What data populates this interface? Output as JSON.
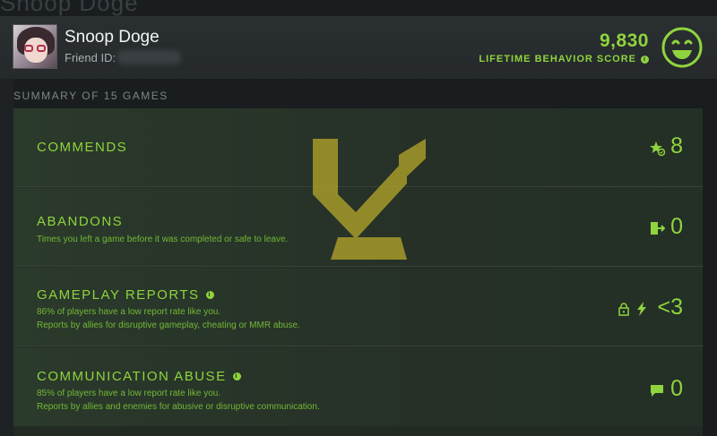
{
  "header": {
    "user_name": "Snoop Doge",
    "friend_id_label": "Friend ID:",
    "score": "9,830",
    "score_label": "LIFETIME BEHAVIOR SCORE",
    "bg_title": "Snoop Doge"
  },
  "summary": {
    "title": "SUMMARY OF 15 GAMES"
  },
  "rows": [
    {
      "title": "COMMENDS",
      "desc1": "",
      "desc2": "",
      "value": "8",
      "icon": "star-commend-icon"
    },
    {
      "title": "ABANDONS",
      "desc1": "Times you left a game before it was completed or safe to leave.",
      "desc2": "",
      "value": "0",
      "icon": "exit-door-icon"
    },
    {
      "title": "GAMEPLAY REPORTS",
      "desc1": "86% of players have a low report rate like you.",
      "desc2": "Reports by allies for disruptive gameplay, cheating or MMR abuse.",
      "value": "<3",
      "icon": "lock-lightning-icon"
    },
    {
      "title": "COMMUNICATION ABUSE",
      "desc1": "85% of players have a low report rate like you.",
      "desc2": "Reports by allies and enemies for abusive or disruptive communication.",
      "value": "0",
      "icon": "chat-bubble-icon"
    }
  ],
  "colors": {
    "accent": "#8fd43e",
    "logo": "#b7a82a"
  }
}
